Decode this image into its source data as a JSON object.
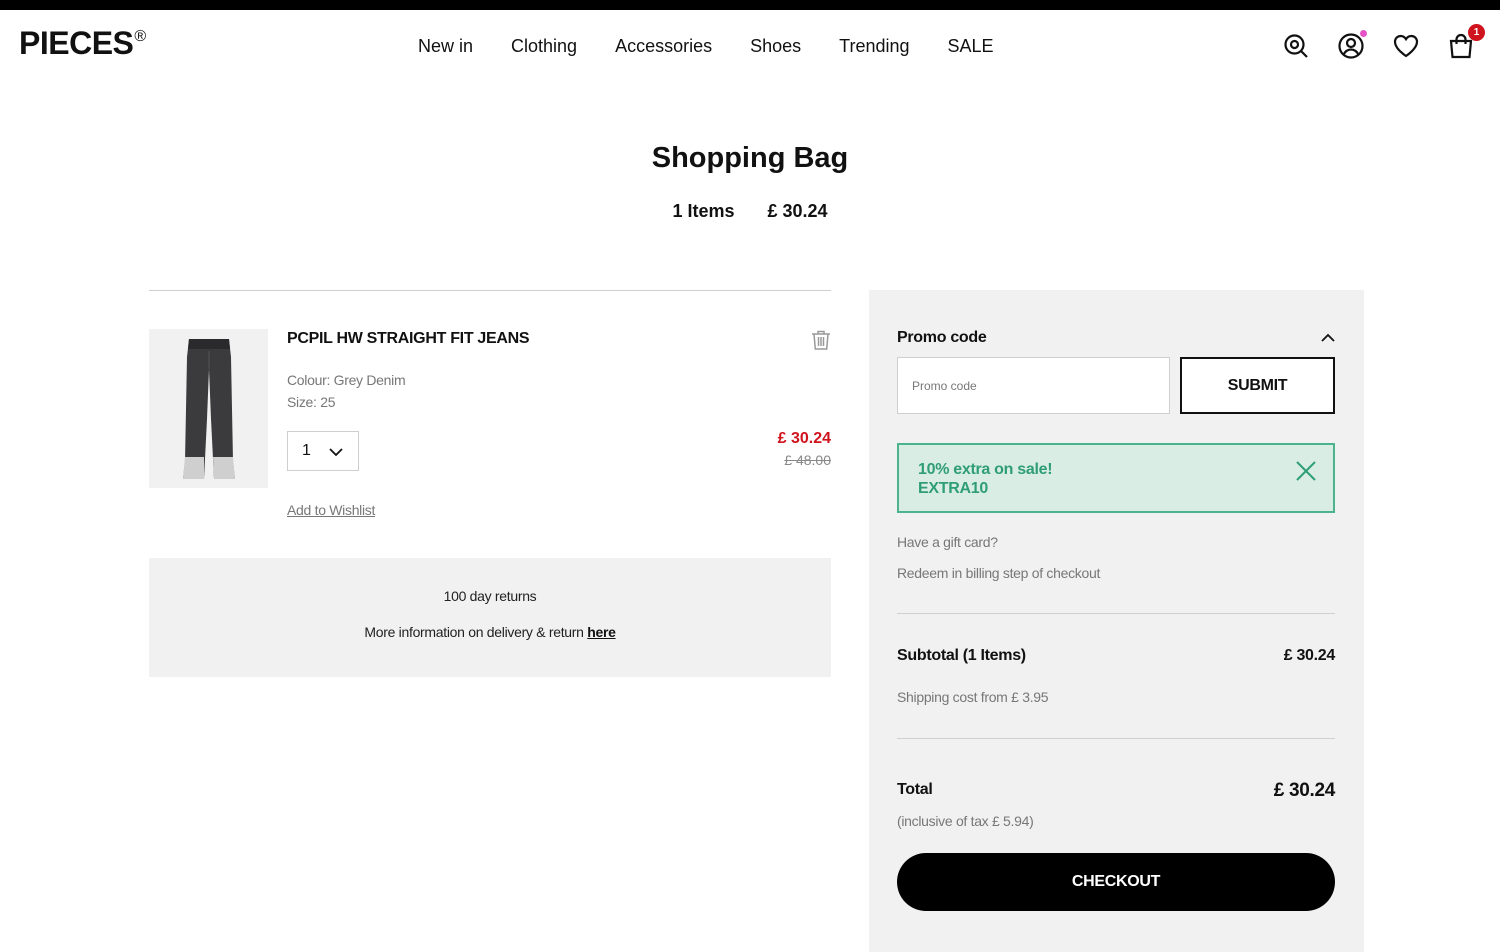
{
  "brand": {
    "name": "PIECES",
    "mark": "®"
  },
  "nav": [
    "New in",
    "Clothing",
    "Accessories",
    "Shoes",
    "Trending",
    "SALE"
  ],
  "header_icons": {
    "search": "search-icon",
    "account": "account-icon",
    "wishlist": "heart-icon",
    "bag": "bag-icon",
    "bag_count": "1",
    "account_dot_color": "#e454c8",
    "badge_color": "#d0141e"
  },
  "page": {
    "title": "Shopping Bag",
    "items_count": "1 Items",
    "total": "£ 30.24"
  },
  "item": {
    "name": "PCPIL HW STRAIGHT FIT JEANS",
    "colour": "Colour: Grey Denim",
    "size": "Size: 25",
    "quantity": "1",
    "price_now": "£ 30.24",
    "price_was": "£ 48.00",
    "wishlist_label": "Add to Wishlist",
    "price_color": "#d0141e"
  },
  "returns": {
    "line1": "100 day returns",
    "line2": "More information on delivery & return ",
    "link": "here"
  },
  "promo": {
    "label": "Promo code",
    "placeholder": "Promo code",
    "submit": "SUBMIT",
    "applied_title": "10% extra on sale!",
    "applied_code": "EXTRA10",
    "applied_color": "#2f9e76"
  },
  "gift": {
    "question": "Have a gift card?",
    "info": "Redeem in billing step of checkout"
  },
  "totals": {
    "subtotal_label": "Subtotal (1 Items)",
    "subtotal_value": "£ 30.24",
    "shipping": "Shipping cost from £ 3.95",
    "total_label": "Total",
    "total_value": "£ 30.24",
    "tax": "(inclusive of tax £ 5.94)"
  },
  "checkout_label": "CHECKOUT"
}
